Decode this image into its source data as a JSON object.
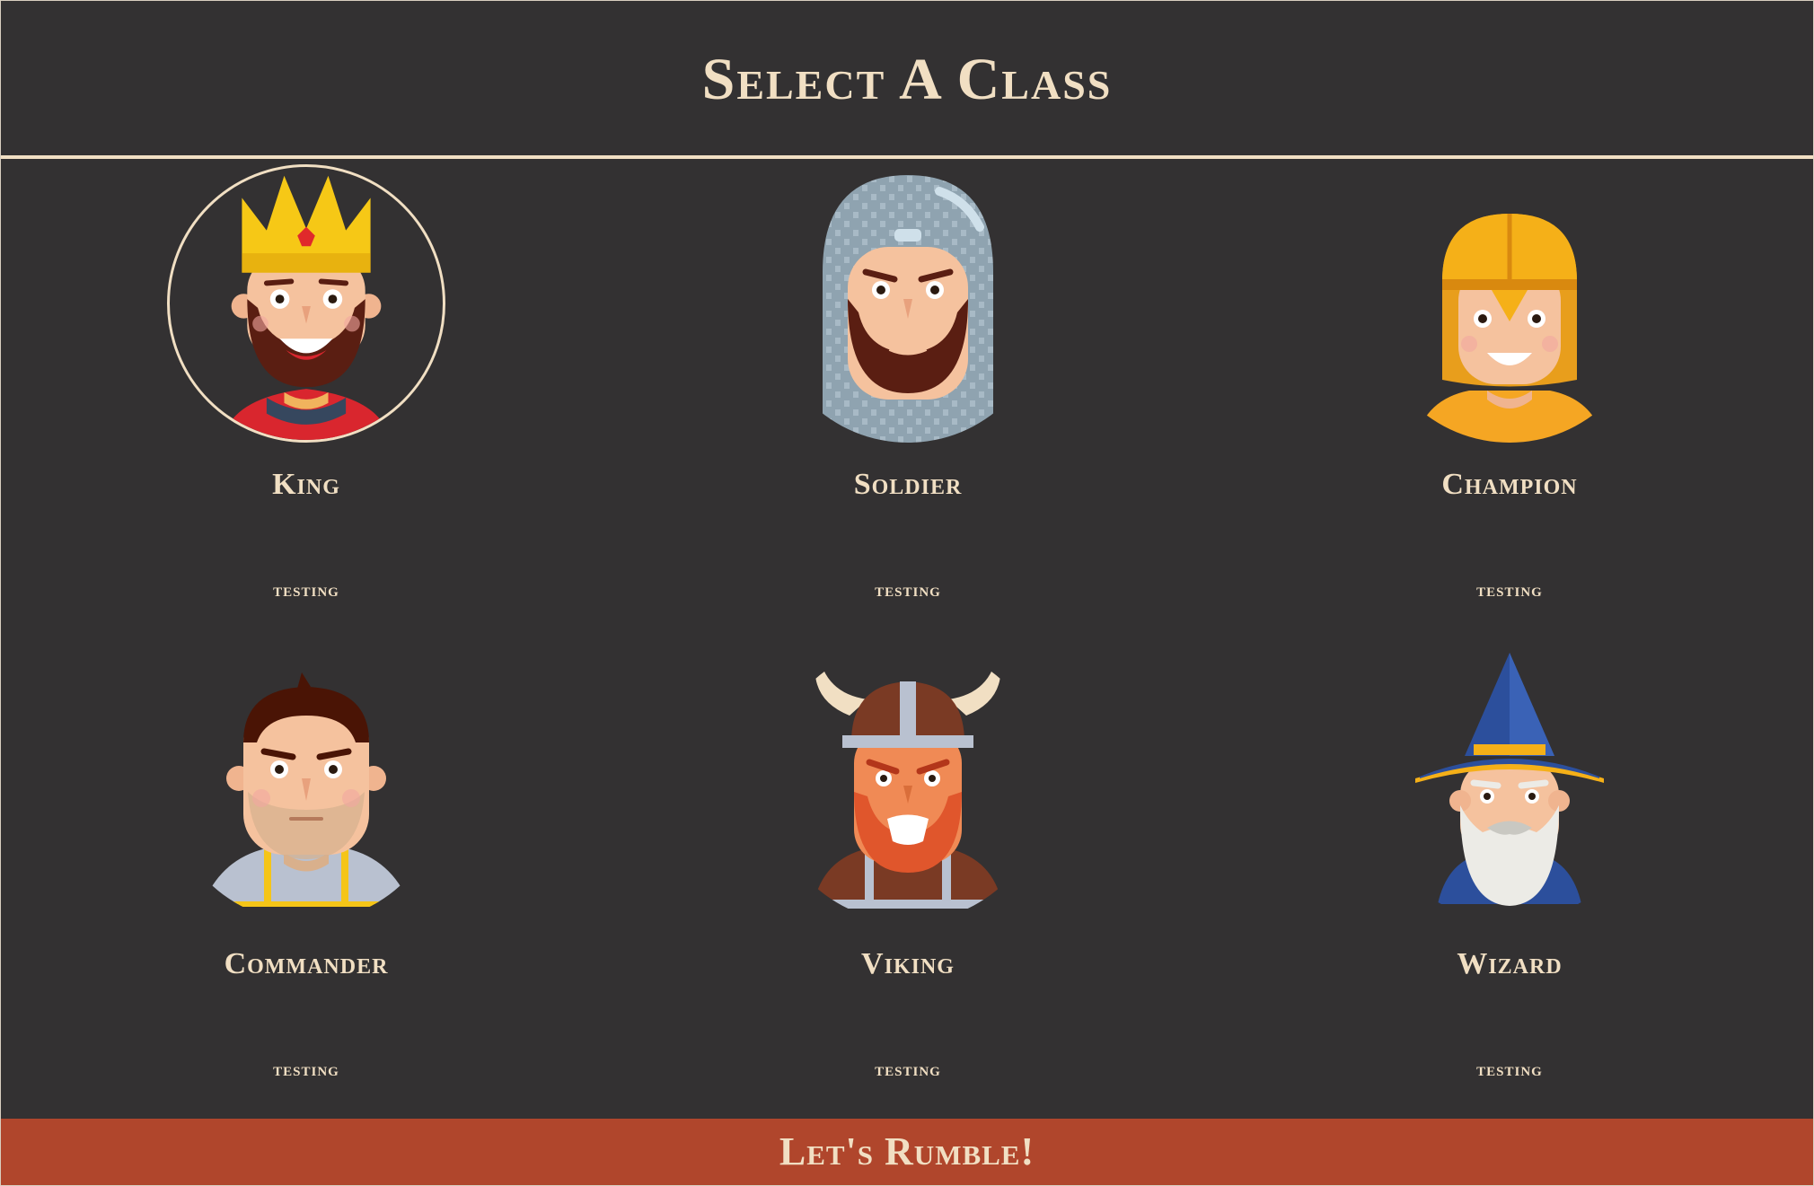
{
  "header": {
    "title": "Select A Class"
  },
  "classes": [
    {
      "name": "King",
      "description": "testing",
      "icon": "king-portrait-icon",
      "selected": true
    },
    {
      "name": "Soldier",
      "description": "testing",
      "icon": "soldier-portrait-icon",
      "selected": false
    },
    {
      "name": "Champion",
      "description": "testing",
      "icon": "champion-portrait-icon",
      "selected": false
    },
    {
      "name": "Commander",
      "description": "testing",
      "icon": "commander-portrait-icon",
      "selected": false
    },
    {
      "name": "Viking",
      "description": "testing",
      "icon": "viking-portrait-icon",
      "selected": false
    },
    {
      "name": "Wizard",
      "description": "testing",
      "icon": "wizard-portrait-icon",
      "selected": false
    }
  ],
  "footer": {
    "button_label": "Let's Rumble!"
  },
  "colors": {
    "background": "#333132",
    "text": "#f1dfc3",
    "button": "#b0462c"
  }
}
